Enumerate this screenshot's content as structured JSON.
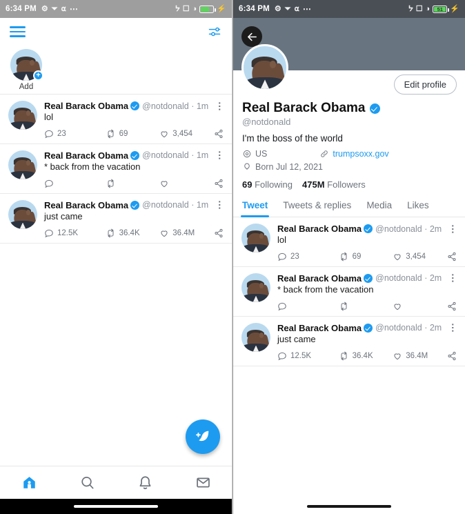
{
  "left": {
    "statusbar": {
      "time": "6:34 PM",
      "icons": [
        "nfc-icon",
        "download-icon",
        "gmail-icon",
        "more-dots-icon"
      ],
      "right_icons": [
        "bluetooth-icon",
        "vibrate-icon",
        "wifi-icon"
      ],
      "battery_level": "",
      "battery_percent": 62
    },
    "appbar": {
      "menu_icon": "hamburger-menu-icon",
      "filter_icon": "sparkle-settings-icon"
    },
    "fleets": {
      "items": [
        {
          "label": "Add",
          "badge": "+",
          "avatar": "user-avatar"
        }
      ]
    },
    "tweets": [
      {
        "name": "Real Barack Obama",
        "handle": "@notdonald",
        "time": "1m",
        "text": "lol",
        "replies": "23",
        "retweets": "69",
        "likes": "3,454",
        "share": "share-icon"
      },
      {
        "name": "Real Barack Obama",
        "handle": "@notdonald",
        "time": "1m",
        "text": "* back from the vacation",
        "replies": "",
        "retweets": "",
        "likes": "",
        "share": "share-icon"
      },
      {
        "name": "Real Barack Obama",
        "handle": "@notdonald",
        "time": "1m",
        "text": "just came",
        "replies": "12.5K",
        "retweets": "36.4K",
        "likes": "36.4M",
        "share": "share-icon"
      }
    ],
    "fab": {
      "name": "compose-tweet-button",
      "icon": "feather-plus-icon"
    },
    "bottomnav": {
      "items": [
        {
          "name": "home",
          "icon": "home-icon",
          "active": true
        },
        {
          "name": "search",
          "icon": "search-icon",
          "active": false
        },
        {
          "name": "notifications",
          "icon": "bell-icon",
          "active": false
        },
        {
          "name": "messages",
          "icon": "envelope-icon",
          "active": false
        }
      ]
    }
  },
  "right": {
    "statusbar": {
      "time": "6:34 PM",
      "icons": [
        "nfc-icon",
        "download-icon",
        "gmail-icon",
        "more-dots-icon"
      ],
      "right_icons": [
        "bluetooth-icon",
        "vibrate-icon",
        "wifi-icon"
      ],
      "battery_level": "51",
      "battery_percent": 51
    },
    "header": {
      "back_icon": "back-arrow-icon",
      "banner_color": "#68747f",
      "edit_profile_label": "Edit profile"
    },
    "profile": {
      "name": "Real Barack Obama",
      "handle": "@notdonald",
      "bio": "I'm the boss of the world",
      "location": "US",
      "location_icon": "location-pin-icon",
      "website": "trumpsoxx.gov",
      "website_icon": "link-icon",
      "birthday": "Born Jul 12, 2021",
      "birthday_icon": "balloon-icon",
      "following_count": "69",
      "following_label": "Following",
      "followers_count": "475M",
      "followers_label": "Followers"
    },
    "tabs": [
      {
        "label": "Tweet",
        "active": true
      },
      {
        "label": "Tweets & replies",
        "active": false
      },
      {
        "label": "Media",
        "active": false
      },
      {
        "label": "Likes",
        "active": false
      }
    ],
    "tweets": [
      {
        "name": "Real Barack Obama",
        "handle": "@notdonald",
        "time": "2m",
        "text": "lol",
        "replies": "23",
        "retweets": "69",
        "likes": "3,454",
        "share": "share-icon"
      },
      {
        "name": "Real Barack Obama",
        "handle": "@notdonald",
        "time": "2m",
        "text": "* back from the vacation",
        "replies": "",
        "retweets": "",
        "likes": "",
        "share": "share-icon"
      },
      {
        "name": "Real Barack Obama",
        "handle": "@notdonald",
        "time": "2m",
        "text": "just came",
        "replies": "12.5K",
        "retweets": "36.4K",
        "likes": "36.4M",
        "share": "share-icon"
      }
    ]
  },
  "colors": {
    "accent": "#1d9bf0",
    "banner": "#68747f",
    "muted": "#6d737b"
  }
}
